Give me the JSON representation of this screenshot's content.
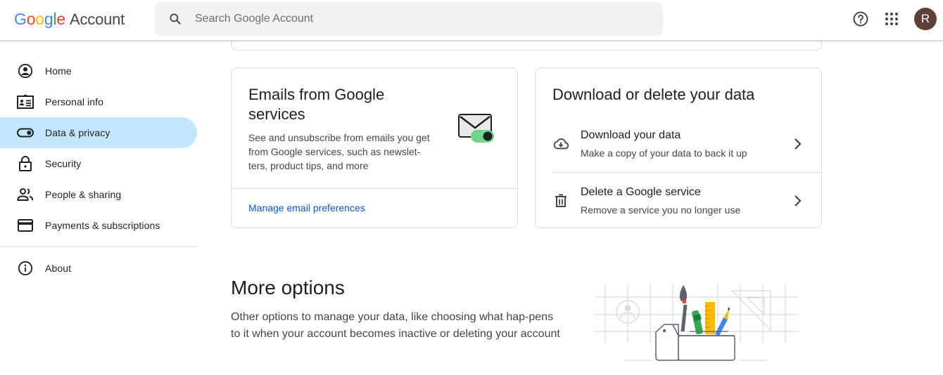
{
  "header": {
    "logo_google": [
      "G",
      "o",
      "o",
      "g",
      "l",
      "e"
    ],
    "logo_colors": [
      "#4285f4",
      "#ea4335",
      "#fbbc04",
      "#4285f4",
      "#34a853",
      "#ea4335"
    ],
    "logo_product": "Account",
    "search_placeholder": "Search Google Account",
    "avatar_initial": "R",
    "avatar_color": "#5d4037"
  },
  "sidebar": {
    "items": [
      {
        "label": "Home",
        "icon": "home-account-icon",
        "active": false
      },
      {
        "label": "Personal info",
        "icon": "id-card-icon",
        "active": false
      },
      {
        "label": "Data & privacy",
        "icon": "toggle-icon",
        "active": true
      },
      {
        "label": "Security",
        "icon": "lock-icon",
        "active": false
      },
      {
        "label": "People & sharing",
        "icon": "people-icon",
        "active": false
      },
      {
        "label": "Payments & subscriptions",
        "icon": "credit-card-icon",
        "active": false
      }
    ],
    "footer_items": [
      {
        "label": "About",
        "icon": "info-icon",
        "active": false
      }
    ],
    "active_color": "#c2e7ff"
  },
  "emails_card": {
    "title": "Emails from Google services",
    "description": "See and unsubscribe from emails you get from Google services, such as newslet-ters, product tips, and more",
    "link": "Manage email preferences"
  },
  "download_card": {
    "title": "Download or delete your data",
    "rows": [
      {
        "title": "Download your data",
        "subtitle": "Make a copy of your data to back it up",
        "icon": "cloud-download-icon"
      },
      {
        "title": "Delete a Google service",
        "subtitle": "Remove a service you no longer use",
        "icon": "trash-icon"
      }
    ]
  },
  "more_options": {
    "title": "More options",
    "description": "Other options to manage your data, like choosing what hap-pens to it when your account becomes inactive or deleting your account"
  },
  "colors": {
    "link": "#0b57d0",
    "toggle_on": "#6dd58c"
  }
}
